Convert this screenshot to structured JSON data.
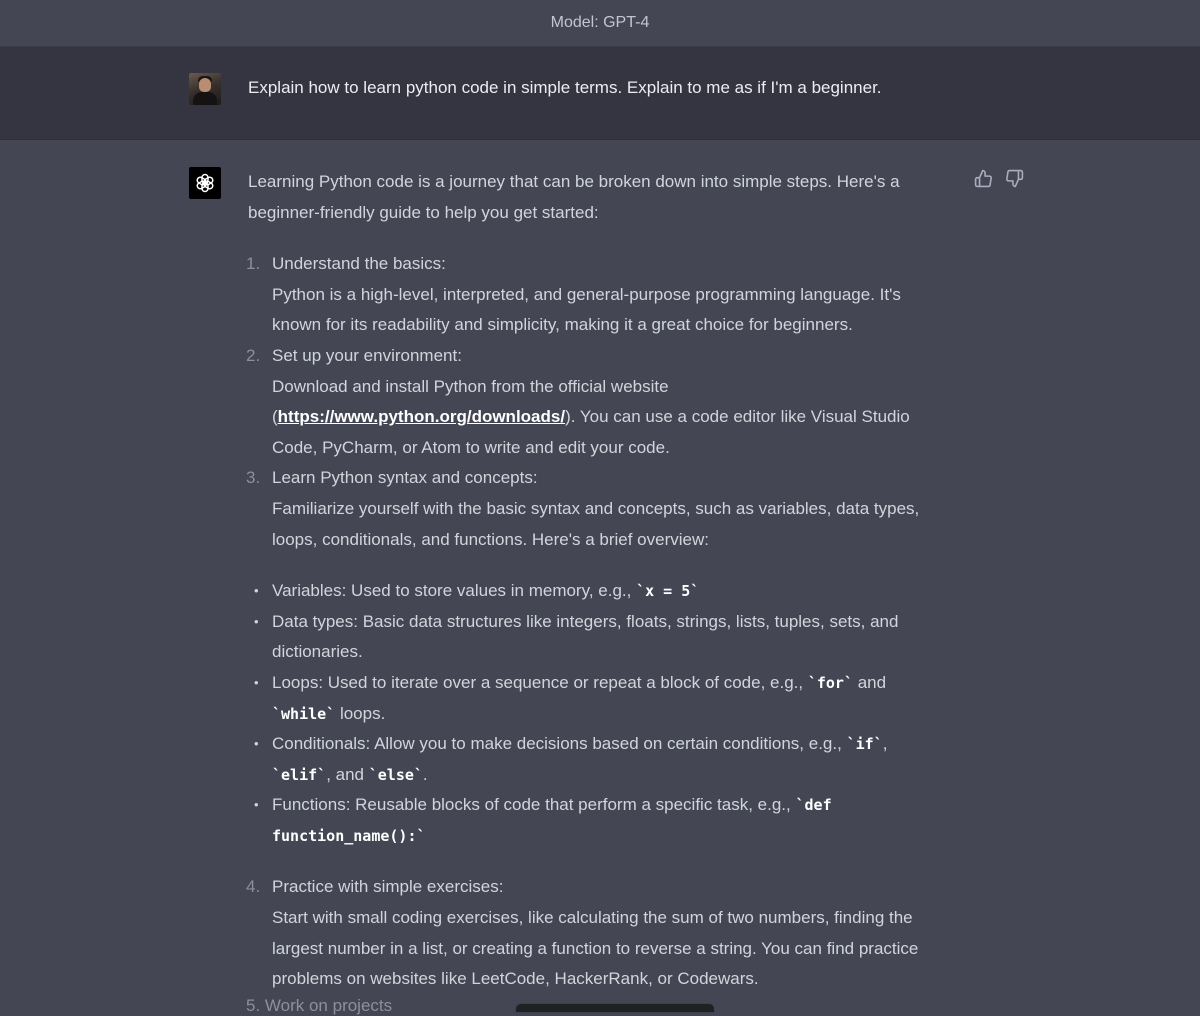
{
  "header": {
    "model_label": "Model: GPT-4"
  },
  "user_message": {
    "text": "Explain how to learn python code in simple terms. Explain to me as if I'm a beginner."
  },
  "assistant": {
    "intro_1": "Learning Python code is a journey that can be broken down into simple steps. Here's a",
    "intro_2": "beginner-friendly guide to help you get started:",
    "steps": [
      {
        "num": "1.",
        "title": "Understand the basics:",
        "lines": [
          "Python is a high-level, interpreted, and general-purpose programming language. It's",
          "known for its readability and simplicity, making it a great choice for beginners."
        ]
      },
      {
        "num": "2.",
        "title": "Set up your environment:",
        "line1": "Download and install Python from the official website",
        "line2_pre": "(",
        "link": "https://www.python.org/downloads/",
        "line2_post": "). You can use a code editor like Visual Studio",
        "line3": "Code, PyCharm, or Atom to write and edit your code."
      },
      {
        "num": "3.",
        "title": "Learn Python syntax and concepts:",
        "lines": [
          "Familiarize yourself with the basic syntax and concepts, such as variables, data types,",
          "loops, conditionals, and functions. Here's a brief overview:"
        ]
      },
      {
        "num": "4.",
        "title": "Practice with simple exercises:",
        "lines": [
          "Start with small coding exercises, like calculating the sum of two numbers, finding the",
          "largest number in a list, or creating a function to reverse a string. You can find practice",
          "problems on websites like LeetCode, HackerRank, or Codewars."
        ]
      }
    ],
    "bullets": {
      "variables_text": "Variables: Used to store values in memory, e.g., ",
      "variables_code": "`x = 5`",
      "datatypes_1": "Data types: Basic data structures like integers, floats, strings, lists, tuples, sets, and",
      "datatypes_2": "dictionaries.",
      "loops_text": "Loops: Used to iterate over a sequence or repeat a block of code, e.g., ",
      "loops_code1": "`for`",
      "loops_and": " and",
      "loops_code2": "`while`",
      "loops_end": " loops.",
      "cond_text": "Conditionals: Allow you to make decisions based on certain conditions, e.g., ",
      "cond_code1": "`if`",
      "cond_comma": ",",
      "cond_code2": "`elif`",
      "cond_and": ", and ",
      "cond_code3": "`else`",
      "cond_end": ".",
      "func_text": "Functions: Reusable blocks of code that perform a specific task, e.g., ",
      "func_code1": "`def",
      "func_code2": "function_name():`"
    },
    "next_step_partial": "5.  Work on projects"
  },
  "icons": {
    "thumbs_up": "thumbs-up-icon",
    "thumbs_down": "thumbs-down-icon",
    "logo": "openai-logo-icon"
  }
}
